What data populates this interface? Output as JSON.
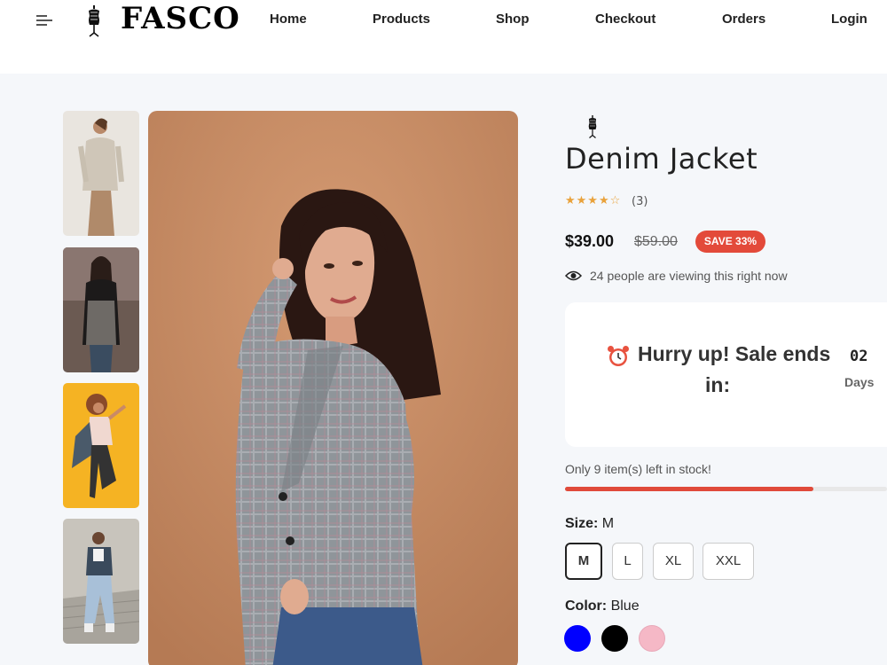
{
  "header": {
    "logo_text": "FASCO",
    "nav": [
      "Home",
      "Products",
      "Shop",
      "Checkout",
      "Orders",
      "Login"
    ]
  },
  "product": {
    "title": "Denim Jacket",
    "rating_stars": "★★★★☆",
    "review_count": "(3)",
    "rating_value": 4,
    "price": "$39.00",
    "old_price": "$59.00",
    "save_badge": "SAVE 33%",
    "viewing_text": "24 people are viewing this right now"
  },
  "sale": {
    "line1": "Hurry up! Sale ends",
    "line2": "in:",
    "days_value": "02",
    "days_label": "Days"
  },
  "stock": {
    "text": "Only 9 item(s) left in stock!",
    "fill_fraction": 0.77
  },
  "size": {
    "label": "Size:",
    "selected": "M",
    "options": [
      "M",
      "L",
      "XL",
      "XXL"
    ]
  },
  "color": {
    "label": "Color:",
    "selected": "Blue",
    "swatches": [
      "#0000ff",
      "#000000",
      "#f5b8c6"
    ]
  },
  "colors": {
    "accent_red": "#e34a3a",
    "star": "#e9a23b",
    "main_bg": "#c48a64"
  },
  "icons": {
    "menu": "menu-icon",
    "logo": "dress-form-icon",
    "eye": "eye-icon",
    "alarm": "alarm-clock-icon"
  }
}
